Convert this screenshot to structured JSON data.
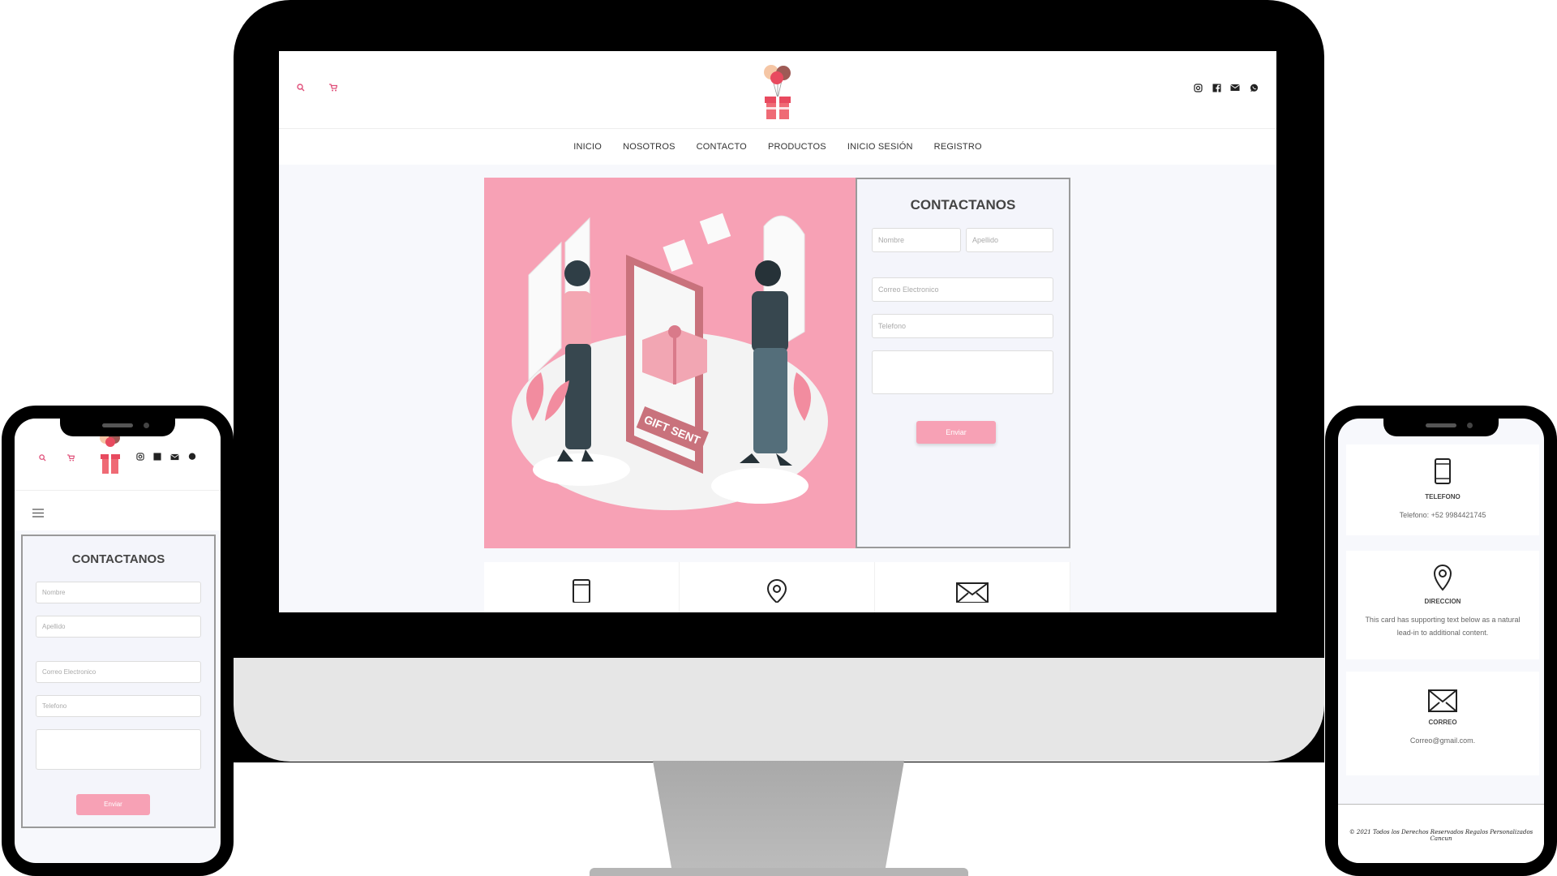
{
  "brand": {
    "accent": "#f7a1b5",
    "text_dark": "#444444"
  },
  "header": {
    "left_icons": [
      "search-icon",
      "cart-icon"
    ],
    "social_icons": [
      "instagram-icon",
      "facebook-icon",
      "mail-icon",
      "whatsapp-icon"
    ]
  },
  "nav": [
    "INICIO",
    "NOSOTROS",
    "CONTACTO",
    "PRODUCTOS",
    "INICIO SESIÓN",
    "REGISTRO"
  ],
  "contact_form": {
    "title": "CONTACTANOS",
    "first_name_placeholder": "Nombre",
    "last_name_placeholder": "Apellido",
    "email_placeholder": "Correo Electronico",
    "phone_placeholder": "Telefono",
    "message_placeholder": "",
    "submit_label": "Enviar"
  },
  "hero": {
    "sign_text": "GIFT SENT"
  },
  "info_cards": [
    {
      "icon": "phone-icon",
      "title": "TELEFONO",
      "text": "Telefono: +52 9984421745"
    },
    {
      "icon": "location-pin-icon",
      "title": "DIRECCION",
      "text": "This card has supporting text below as a natural lead-in to additional content."
    },
    {
      "icon": "envelope-icon",
      "title": "CORREO",
      "text": "Correo@gmail.com."
    }
  ],
  "footer": {
    "text": "© 2021 Todos los Derechos Reservados Regalos Personalizados Cancun"
  }
}
